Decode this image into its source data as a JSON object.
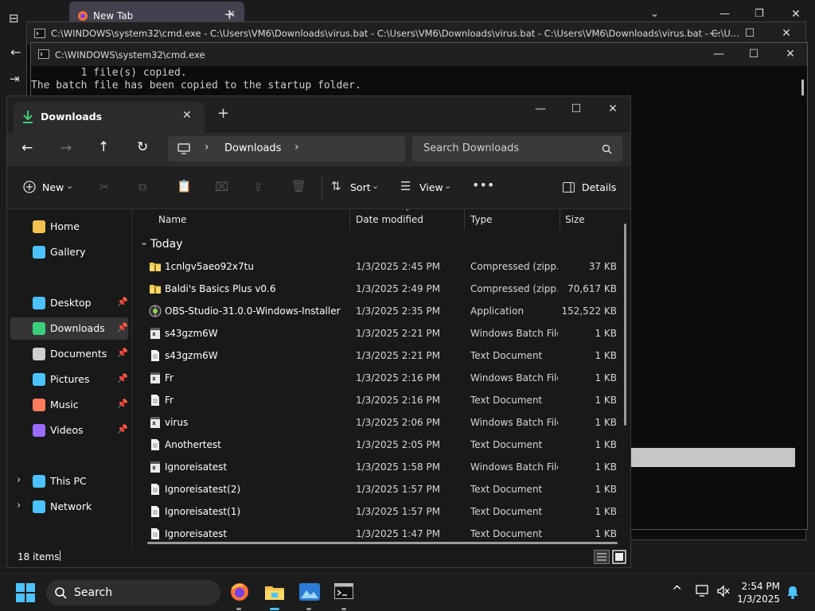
{
  "browser": {
    "tab_title": "New Tab"
  },
  "cmd1": {
    "title": "C:\\WINDOWS\\system32\\cmd.exe - C:\\Users\\VM6\\Downloads\\virus.bat - C:\\Users\\VM6\\Downloads\\virus.bat - C:\\Users\\VM6\\Downloads\\virus.bat - C:\\U..."
  },
  "cmd2": {
    "title": "C:\\WINDOWS\\system32\\cmd.exe",
    "lines": [
      "        1 file(s) copied.",
      "The batch file has been copied to the startup folder."
    ]
  },
  "explorer": {
    "tab_title": "Downloads",
    "address": {
      "segments": [
        "Downloads"
      ]
    },
    "search_placeholder": "Search Downloads",
    "toolbar": {
      "new": "New",
      "sort": "Sort",
      "view": "View",
      "details": "Details"
    },
    "sidebar": [
      {
        "label": "Home",
        "icon": "home-icon"
      },
      {
        "label": "Gallery",
        "icon": "gallery-icon"
      },
      {
        "label": "Desktop",
        "icon": "desktop-icon",
        "pinned": true
      },
      {
        "label": "Downloads",
        "icon": "downloads-icon",
        "pinned": true,
        "selected": true
      },
      {
        "label": "Documents",
        "icon": "documents-icon",
        "pinned": true
      },
      {
        "label": "Pictures",
        "icon": "pictures-icon",
        "pinned": true
      },
      {
        "label": "Music",
        "icon": "music-icon",
        "pinned": true
      },
      {
        "label": "Videos",
        "icon": "videos-icon",
        "pinned": true
      },
      {
        "label": "This PC",
        "icon": "this-pc-icon"
      },
      {
        "label": "Network",
        "icon": "network-icon"
      }
    ],
    "columns": {
      "name": "Name",
      "date": "Date modified",
      "type": "Type",
      "size": "Size"
    },
    "group_label": "Today",
    "files": [
      {
        "name": "1cnlgv5aeo92x7tu",
        "date": "1/3/2025 2:45 PM",
        "type": "Compressed (zipp...",
        "size": "37 KB",
        "icon": "zip"
      },
      {
        "name": "Baldi's Basics Plus v0.6",
        "date": "1/3/2025 2:49 PM",
        "type": "Compressed (zipp...",
        "size": "70,617 KB",
        "icon": "zip"
      },
      {
        "name": "OBS-Studio-31.0.0-Windows-Installer",
        "date": "1/3/2025 2:35 PM",
        "type": "Application",
        "size": "152,522 KB",
        "icon": "app"
      },
      {
        "name": "s43gzm6W",
        "date": "1/3/2025 2:21 PM",
        "type": "Windows Batch File",
        "size": "1 KB",
        "icon": "bat"
      },
      {
        "name": "s43gzm6W",
        "date": "1/3/2025 2:21 PM",
        "type": "Text Document",
        "size": "1 KB",
        "icon": "txt"
      },
      {
        "name": "Fr",
        "date": "1/3/2025 2:16 PM",
        "type": "Windows Batch File",
        "size": "1 KB",
        "icon": "bat"
      },
      {
        "name": "Fr",
        "date": "1/3/2025 2:16 PM",
        "type": "Text Document",
        "size": "1 KB",
        "icon": "txt"
      },
      {
        "name": "virus",
        "date": "1/3/2025 2:06 PM",
        "type": "Windows Batch File",
        "size": "1 KB",
        "icon": "bat"
      },
      {
        "name": "Anothertest",
        "date": "1/3/2025 2:05 PM",
        "type": "Text Document",
        "size": "1 KB",
        "icon": "txt"
      },
      {
        "name": "Ignoreisatest",
        "date": "1/3/2025 1:58 PM",
        "type": "Windows Batch File",
        "size": "1 KB",
        "icon": "bat"
      },
      {
        "name": "Ignoreisatest(2)",
        "date": "1/3/2025 1:57 PM",
        "type": "Text Document",
        "size": "1 KB",
        "icon": "txt"
      },
      {
        "name": "Ignoreisatest(1)",
        "date": "1/3/2025 1:57 PM",
        "type": "Text Document",
        "size": "1 KB",
        "icon": "txt"
      },
      {
        "name": "Ignoreisatest",
        "date": "1/3/2025 1:47 PM",
        "type": "Text Document",
        "size": "1 KB",
        "icon": "txt"
      }
    ],
    "status": "18 items"
  },
  "taskbar": {
    "search_label": "Search",
    "time": "2:54 PM",
    "date": "1/3/2025"
  },
  "colors": {
    "accent": "#4cc2ff",
    "folder": "#f2c14e",
    "pin": "#cfcfcf"
  }
}
